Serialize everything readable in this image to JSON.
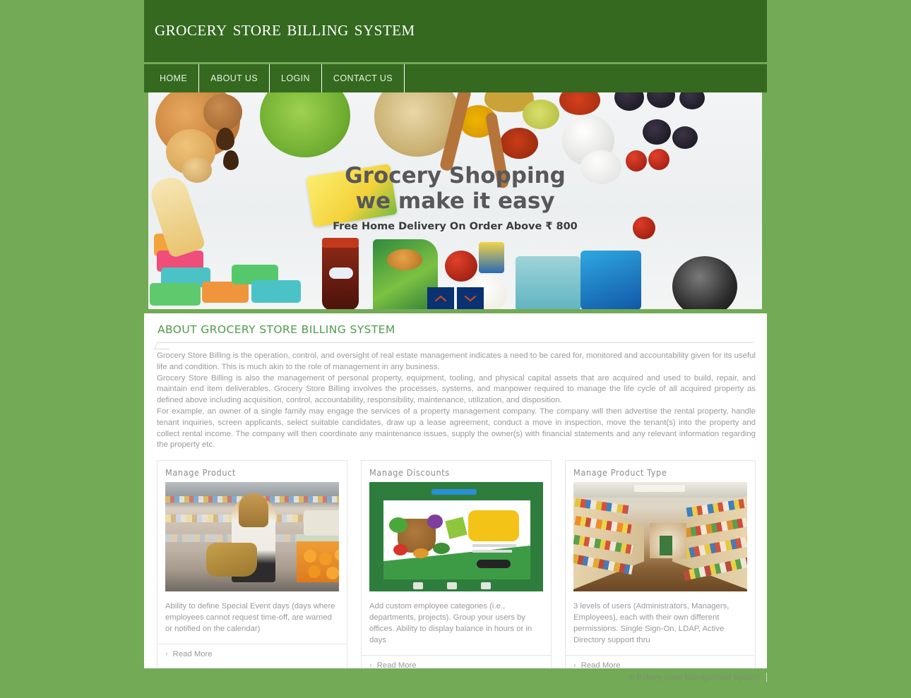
{
  "site": {
    "title": "Grocery Store Billing System",
    "brand_green": "#34691f",
    "page_green": "#72aa55",
    "accent_green": "#4e9c4a"
  },
  "nav": {
    "items": [
      {
        "label": "HOME"
      },
      {
        "label": "ABOUT US"
      },
      {
        "label": "LOGIN"
      },
      {
        "label": "CONTACT US"
      }
    ]
  },
  "banner": {
    "headline_line1": "Grocery Shopping",
    "headline_line2": "we make it easy",
    "subline": "Free Home Delivery On Order Above ₹ 800",
    "prev_icon": "chevron-up-icon",
    "next_icon": "chevron-down-icon",
    "arrow_color": "#0a3171"
  },
  "about": {
    "heading": "ABOUT GROCERY STORE BILLING SYSTEM",
    "paragraphs": [
      "Grocery Store Billing is the operation, control, and oversight of real estate management indicates a need to be cared for, monitored and accountability given for its useful life and condition. This is much akin to the role of management in any business.",
      "Grocery Store Billing is also the management of personal property, equipment, tooling, and physical capital assets that are acquired and used to build, repair, and maintain end item deliverables. Grocery Store Billing involves the processes, systems, and manpower required to manage the life cycle of all acquired property as defined above including acquisition, control, accountability, responsibility, maintenance, utilization, and disposition.",
      "For example, an owner of a single family may engage the services of a property management company. The company will then advertise the rental property, handle tenant inquiries, screen applicants, select suitable candidates, draw up a lease agreement, conduct a move in inspection, move the tenant(s) into the property and collect rental income. The company will then coordinate any maintenance issues, supply the owner(s) with financial statements and any relevant information regarding the property etc."
    ]
  },
  "cards": [
    {
      "title": "Manage Product",
      "image_alt": "shopper-in-grocery-aisle-photo",
      "description": "Ability to define Special Event days (days where employees cannot request time-off, are warned or notified on the calendar)",
      "read_more": "Read More",
      "chevron": "chevron-right-icon"
    },
    {
      "title": "Manage Discounts",
      "image_alt": "grocery-sale-discount-banner-photo",
      "description": "Add custom employee categories (i.e., departments, projects). Group your users by offices. Ability to display balance in hours or in days",
      "read_more": "Read More",
      "chevron": "chevron-right-icon"
    },
    {
      "title": "Manage Product Type",
      "image_alt": "supermarket-shelves-aisle-photo",
      "description": "3 levels of users (Administrators, Managers, Employees), each with their own different permissions. Single Sign-On, LDAP, Active Directory support thru",
      "read_more": "Read More",
      "chevron": "chevron-right-icon"
    }
  ],
  "footer": {
    "copyright": "© Bakery Shop Management System"
  }
}
